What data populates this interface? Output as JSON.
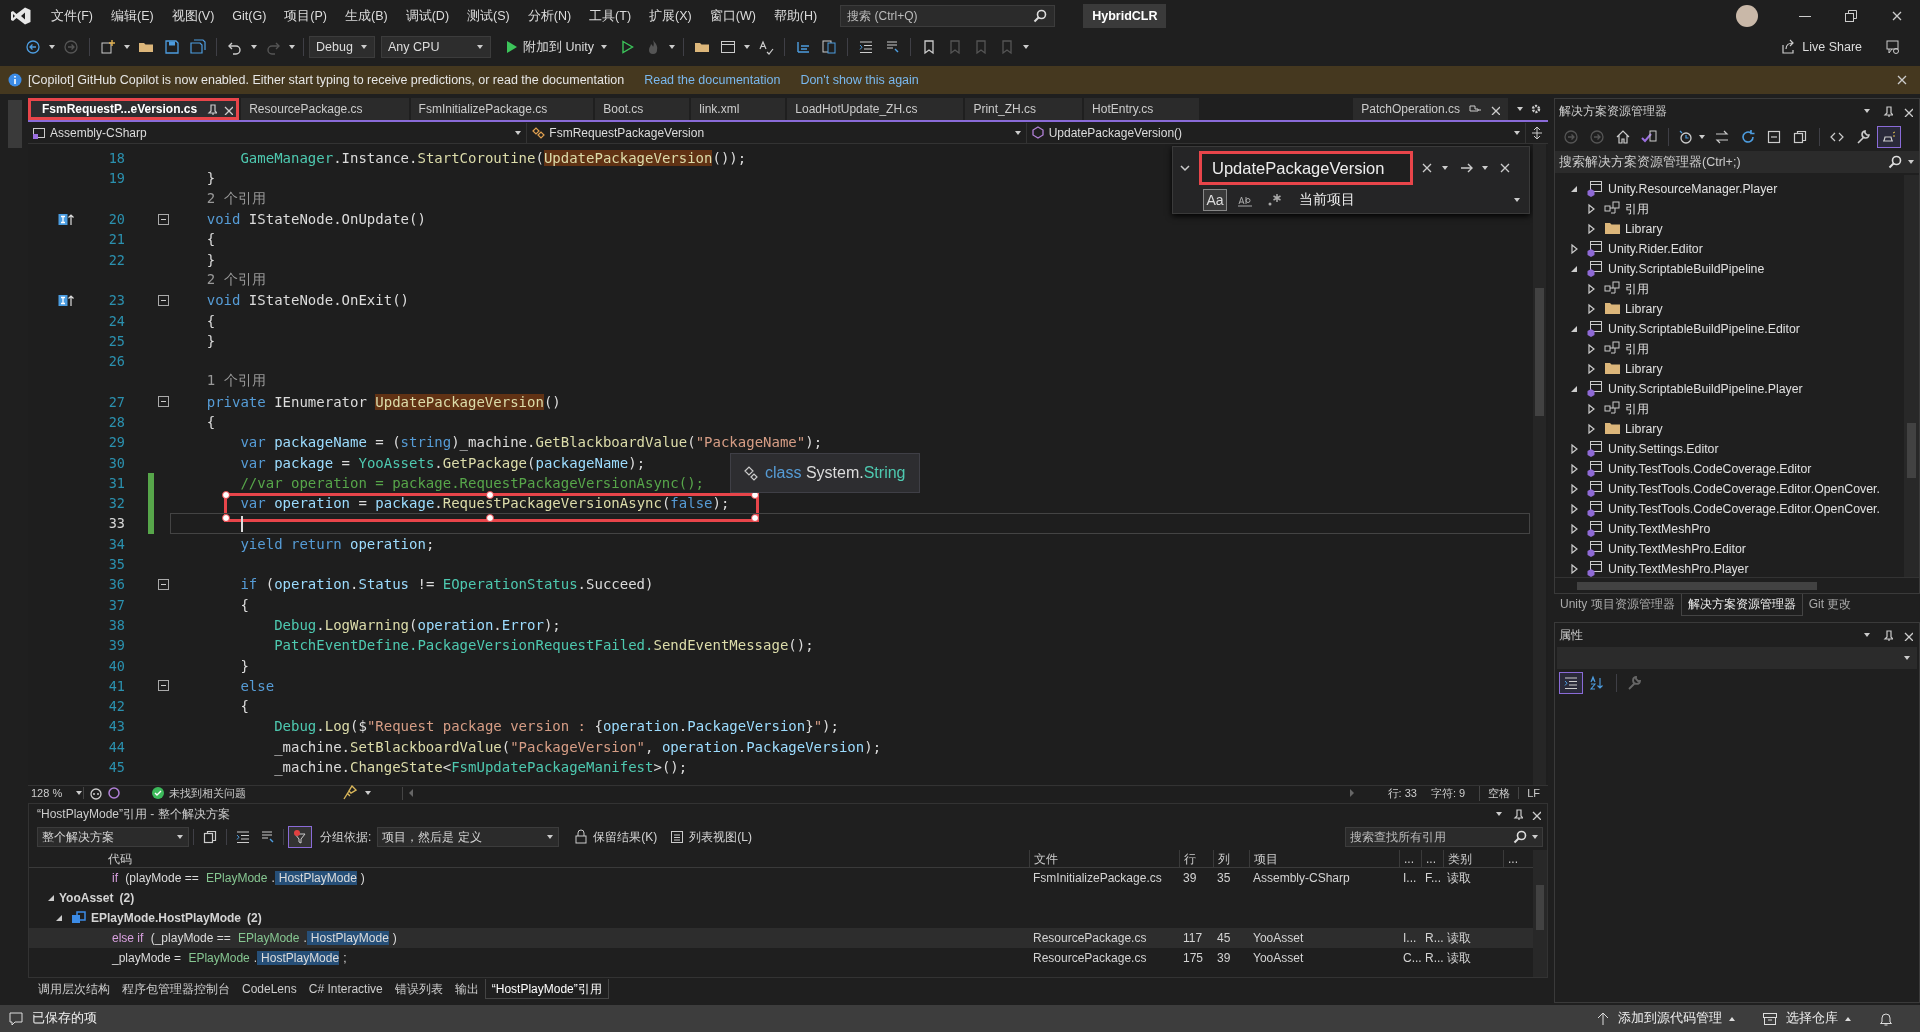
{
  "title_bar": {
    "menu": [
      "文件(F)",
      "编辑(E)",
      "视图(V)",
      "Git(G)",
      "项目(P)",
      "生成(B)",
      "调试(D)",
      "测试(S)",
      "分析(N)",
      "工具(T)",
      "扩展(X)",
      "窗口(W)",
      "帮助(H)"
    ],
    "search": {
      "placeholder": "搜索 (Ctrl+Q)"
    },
    "solution_name": "HybridCLR"
  },
  "toolbar": {
    "configuration": "Debug",
    "platform": "Any CPU",
    "attach_button": "附加到 Unity",
    "live_share": "Live Share"
  },
  "info_bar": {
    "message": "[Copilot] GitHub Copilot is now enabled. Either start typing to receive predictions, or read the documentation",
    "links": [
      "Read the documentation",
      "Don't show this again"
    ]
  },
  "editor": {
    "tabs": [
      {
        "label": "FsmRequestP...eVersion.cs",
        "selected": true,
        "annotated": true
      },
      {
        "label": "ResourcePackage.cs",
        "selected": false,
        "annotated": false
      },
      {
        "label": "FsmInitializePackage.cs",
        "selected": false,
        "annotated": false
      },
      {
        "label": "Boot.cs",
        "selected": false,
        "annotated": false
      },
      {
        "label": "link.xml",
        "selected": false,
        "annotated": false
      },
      {
        "label": "LoadHotUpdate_ZH.cs",
        "selected": false,
        "annotated": false
      },
      {
        "label": "Print_ZH.cs",
        "selected": false,
        "annotated": false
      },
      {
        "label": "HotEntry.cs",
        "selected": false,
        "annotated": false
      }
    ],
    "pinned_tabs": [
      {
        "label": "PatchOperation.cs",
        "selected": false
      }
    ],
    "nav": {
      "project": "Assembly-CSharp",
      "type": "FsmRequestPackageVersion",
      "member": "UpdatePackageVersion()"
    },
    "find": {
      "value": "UpdatePackageVersion",
      "annotated": true,
      "match_case_label": "Aa",
      "match_case": true,
      "whole_word": false,
      "regex": false,
      "scope": "当前项目"
    },
    "lines": [
      {
        "kind": "code",
        "number": "18",
        "tokens": [
          {
            "text": "        GameManager",
            "kind": "type"
          },
          {
            "text": ".Instance.",
            "kind": "plain"
          },
          {
            "text": "StartCoroutine",
            "kind": "method"
          },
          {
            "text": "(",
            "kind": "plain"
          },
          {
            "text": "UpdatePackageVersion",
            "kind": "reference"
          },
          {
            "text": "());",
            "kind": "plain"
          }
        ]
      },
      {
        "kind": "code",
        "number": "19",
        "tokens": [
          {
            "text": "    }",
            "kind": "plain"
          }
        ]
      },
      {
        "kind": "codelens",
        "text": "    2 个引用"
      },
      {
        "kind": "code",
        "number": "20",
        "implements": true,
        "fold": true,
        "tokens": [
          {
            "text": "    void",
            "kind": "keyword"
          },
          {
            "text": " IStateNode.OnUpdate()",
            "kind": "plain"
          }
        ]
      },
      {
        "kind": "code",
        "number": "21",
        "tokens": [
          {
            "text": "    {",
            "kind": "plain"
          }
        ]
      },
      {
        "kind": "code",
        "number": "22",
        "tokens": [
          {
            "text": "    }",
            "kind": "plain"
          }
        ]
      },
      {
        "kind": "codelens",
        "text": "    2 个引用"
      },
      {
        "kind": "code",
        "number": "23",
        "implements": true,
        "fold": true,
        "tokens": [
          {
            "text": "    void",
            "kind": "keyword"
          },
          {
            "text": " IStateNode.OnExit()",
            "kind": "plain"
          }
        ]
      },
      {
        "kind": "code",
        "number": "24",
        "tokens": [
          {
            "text": "    {",
            "kind": "plain"
          }
        ]
      },
      {
        "kind": "code",
        "number": "25",
        "tokens": [
          {
            "text": "    }",
            "kind": "plain"
          }
        ]
      },
      {
        "kind": "code",
        "number": "26"
      },
      {
        "kind": "codelens",
        "text": "    1 个引用"
      },
      {
        "kind": "code",
        "number": "27",
        "fold": true,
        "tokens": [
          {
            "text": "    private",
            "kind": "keyword"
          },
          {
            "text": " IEnumerator ",
            "kind": "plain"
          },
          {
            "text": "UpdatePackageVersion",
            "kind": "reference"
          },
          {
            "text": "()",
            "kind": "plain"
          }
        ]
      },
      {
        "kind": "code",
        "number": "28",
        "tokens": [
          {
            "text": "    {",
            "kind": "plain"
          }
        ]
      },
      {
        "kind": "code",
        "number": "29",
        "tokens": [
          {
            "text": "        var",
            "kind": "keyword"
          },
          {
            "text": " packageName",
            "kind": "variable"
          },
          {
            "text": " = (",
            "kind": "plain"
          },
          {
            "text": "string",
            "kind": "keyword"
          },
          {
            "text": ")_machine.",
            "kind": "plain"
          },
          {
            "text": "GetBlackboardValue",
            "kind": "method"
          },
          {
            "text": "(",
            "kind": "plain"
          },
          {
            "text": "\"PackageName\"",
            "kind": "string"
          },
          {
            "text": ");",
            "kind": "plain"
          }
        ]
      },
      {
        "kind": "code",
        "number": "30",
        "tokens": [
          {
            "text": "        var",
            "kind": "keyword"
          },
          {
            "text": " package",
            "kind": "variable"
          },
          {
            "text": " = ",
            "kind": "plain"
          },
          {
            "text": "YooAssets",
            "kind": "type"
          },
          {
            "text": ".",
            "kind": "plain"
          },
          {
            "text": "GetPackage",
            "kind": "method"
          },
          {
            "text": "(",
            "kind": "plain"
          },
          {
            "text": "packageName",
            "kind": "variable"
          },
          {
            "text": ");",
            "kind": "plain"
          }
        ]
      },
      {
        "kind": "code",
        "number": "31",
        "changed": true,
        "tokens": [
          {
            "text": "        //var operation = package.RequestPackageVersionAsync();",
            "kind": "comment"
          }
        ]
      },
      {
        "kind": "code",
        "number": "32",
        "changed": true,
        "annotated": true,
        "tokens": [
          {
            "text": "        var",
            "kind": "keyword"
          },
          {
            "text": " operation",
            "kind": "variable"
          },
          {
            "text": " = ",
            "kind": "plain"
          },
          {
            "text": "package",
            "kind": "variable"
          },
          {
            "text": ".",
            "kind": "plain"
          },
          {
            "text": "RequestPackageVersionAsync",
            "kind": "method"
          },
          {
            "text": "(",
            "kind": "plain"
          },
          {
            "text": "false",
            "kind": "keyword"
          },
          {
            "text": ");",
            "kind": "plain"
          }
        ]
      },
      {
        "kind": "code",
        "number": "33",
        "changed": true,
        "current": true
      },
      {
        "kind": "code",
        "number": "34",
        "tokens": [
          {
            "text": "        yield return",
            "kind": "keyword"
          },
          {
            "text": " operation",
            "kind": "variable"
          },
          {
            "text": ";",
            "kind": "plain"
          }
        ]
      },
      {
        "kind": "code",
        "number": "35"
      },
      {
        "kind": "code",
        "number": "36",
        "fold": true,
        "tokens": [
          {
            "text": "        if",
            "kind": "keyword"
          },
          {
            "text": " (",
            "kind": "plain"
          },
          {
            "text": "operation",
            "kind": "variable"
          },
          {
            "text": ".",
            "kind": "plain"
          },
          {
            "text": "Status",
            "kind": "variable"
          },
          {
            "text": " != ",
            "kind": "plain"
          },
          {
            "text": "EOperationStatus",
            "kind": "type"
          },
          {
            "text": ".Succeed)",
            "kind": "plain"
          }
        ]
      },
      {
        "kind": "code",
        "number": "37",
        "tokens": [
          {
            "text": "        {",
            "kind": "plain"
          }
        ]
      },
      {
        "kind": "code",
        "number": "38",
        "tokens": [
          {
            "text": "            Debug",
            "kind": "type"
          },
          {
            "text": ".",
            "kind": "plain"
          },
          {
            "text": "LogWarning",
            "kind": "method"
          },
          {
            "text": "(",
            "kind": "plain"
          },
          {
            "text": "operation",
            "kind": "variable"
          },
          {
            "text": ".",
            "kind": "plain"
          },
          {
            "text": "Error",
            "kind": "variable"
          },
          {
            "text": ");",
            "kind": "plain"
          }
        ]
      },
      {
        "kind": "code",
        "number": "39",
        "tokens": [
          {
            "text": "            PatchEventDefine",
            "kind": "type"
          },
          {
            "text": ".PackageVersionRequestFailed.",
            "kind": "type"
          },
          {
            "text": "SendEventMessage",
            "kind": "method"
          },
          {
            "text": "();",
            "kind": "plain"
          }
        ]
      },
      {
        "kind": "code",
        "number": "40",
        "tokens": [
          {
            "text": "        }",
            "kind": "plain"
          }
        ]
      },
      {
        "kind": "code",
        "number": "41",
        "fold": true,
        "tokens": [
          {
            "text": "        else",
            "kind": "keyword"
          }
        ]
      },
      {
        "kind": "code",
        "number": "42",
        "tokens": [
          {
            "text": "        {",
            "kind": "plain"
          }
        ]
      },
      {
        "kind": "code",
        "number": "43",
        "tokens": [
          {
            "text": "            Debug",
            "kind": "type"
          },
          {
            "text": ".",
            "kind": "plain"
          },
          {
            "text": "Log",
            "kind": "method"
          },
          {
            "text": "($",
            "kind": "plain"
          },
          {
            "text": "\"Request package version : ",
            "kind": "string"
          },
          {
            "text": "{",
            "kind": "plain"
          },
          {
            "text": "operation",
            "kind": "variable"
          },
          {
            "text": ".",
            "kind": "plain"
          },
          {
            "text": "PackageVersion",
            "kind": "variable"
          },
          {
            "text": "}",
            "kind": "plain"
          },
          {
            "text": "\"",
            "kind": "string"
          },
          {
            "text": ");",
            "kind": "plain"
          }
        ]
      },
      {
        "kind": "code",
        "number": "44",
        "tokens": [
          {
            "text": "            _machine.",
            "kind": "plain"
          },
          {
            "text": "SetBlackboardValue",
            "kind": "method"
          },
          {
            "text": "(",
            "kind": "plain"
          },
          {
            "text": "\"PackageVersion\"",
            "kind": "string"
          },
          {
            "text": ", ",
            "kind": "plain"
          },
          {
            "text": "operation",
            "kind": "variable"
          },
          {
            "text": ".",
            "kind": "plain"
          },
          {
            "text": "PackageVersion",
            "kind": "variable"
          },
          {
            "text": ");",
            "kind": "plain"
          }
        ]
      },
      {
        "kind": "code",
        "number": "45",
        "tokens": [
          {
            "text": "            _machine.",
            "kind": "plain"
          },
          {
            "text": "ChangeState",
            "kind": "method"
          },
          {
            "text": "<",
            "kind": "plain"
          },
          {
            "text": "FsmUpdatePackageManifest",
            "kind": "type"
          },
          {
            "text": ">();",
            "kind": "plain"
          }
        ]
      }
    ],
    "tooltip": {
      "tokens": [
        {
          "text": "class",
          "kind": "keyword"
        },
        {
          "text": " System.",
          "kind": "plain"
        },
        {
          "text": "String",
          "kind": "type"
        }
      ]
    },
    "status": {
      "zoom": "128 %",
      "issues": "未找到相关问题",
      "line": "行: 33",
      "char": "字符: 9",
      "spacing": "空格",
      "eol": "LF"
    }
  },
  "references": {
    "title": "“HostPlayMode”引用 - 整个解决方案",
    "scope": "整个解决方案",
    "group_by_label": "分组依据:",
    "group_by": "项目，然后是 定义",
    "keep_results": "保留结果(K)",
    "list_view": "列表视图(L)",
    "search": {
      "placeholder": "搜索查找所有引用"
    },
    "columns": [
      "代码",
      "文件",
      "行",
      "列",
      "项目",
      "...",
      "...",
      "类别",
      "..."
    ],
    "items": [
      {
        "kind": "result",
        "selected": false,
        "code": [
          {
            "text": "if",
            "kind": "keyword"
          },
          {
            "text": " (playMode == ",
            "kind": "plain"
          },
          {
            "text": "EPlayMode",
            "kind": "type"
          },
          {
            "text": ".",
            "kind": "plain"
          },
          {
            "text": "HostPlayMode",
            "kind": "match"
          },
          {
            "text": ")",
            "kind": "plain"
          }
        ],
        "cells": [
          "FsmInitializePackage.cs",
          "39",
          "35",
          "Assembly-CSharp",
          "I...",
          "F...",
          "读取"
        ]
      },
      {
        "kind": "group",
        "label": "YooAsset",
        "count": "(2)",
        "expanded": true,
        "children": [
          {
            "kind": "group",
            "label": "EPlayMode.HostPlayMode",
            "count": "(2)",
            "expanded": true,
            "children": [
              {
                "kind": "result",
                "selected": true,
                "code": [
                  {
                    "text": "else if",
                    "kind": "keyword"
                  },
                  {
                    "text": " (_playMode == ",
                    "kind": "plain"
                  },
                  {
                    "text": "EPlayMode",
                    "kind": "type"
                  },
                  {
                    "text": ".",
                    "kind": "plain"
                  },
                  {
                    "text": "HostPlayMode",
                    "kind": "match"
                  },
                  {
                    "text": ")",
                    "kind": "plain"
                  }
                ],
                "cells": [
                  "ResourcePackage.cs",
                  "117",
                  "45",
                  "YooAsset",
                  "I...",
                  "R...",
                  "读取"
                ]
              },
              {
                "kind": "result",
                "selected": false,
                "code": [
                  {
                    "text": "_playMode = ",
                    "kind": "plain"
                  },
                  {
                    "text": "EPlayMode",
                    "kind": "type"
                  },
                  {
                    "text": ".",
                    "kind": "plain"
                  },
                  {
                    "text": "HostPlayMode",
                    "kind": "match"
                  },
                  {
                    "text": ";",
                    "kind": "plain"
                  }
                ],
                "cells": [
                  "ResourcePackage.cs",
                  "175",
                  "39",
                  "YooAsset",
                  "C...",
                  "R...",
                  "读取"
                ]
              }
            ]
          }
        ]
      }
    ]
  },
  "tool_tabs": [
    {
      "label": "调用层次结构",
      "selected": false
    },
    {
      "label": "程序包管理器控制台",
      "selected": false
    },
    {
      "label": "CodeLens",
      "selected": false
    },
    {
      "label": "C# Interactive",
      "selected": false
    },
    {
      "label": "错误列表",
      "selected": false
    },
    {
      "label": "输出",
      "selected": false
    },
    {
      "label": "“HostPlayMode”引用",
      "selected": true
    }
  ],
  "solution_explorer": {
    "title": "解决方案资源管理器",
    "search": {
      "placeholder": "搜索解决方案资源管理器(Ctrl+;)"
    },
    "tree": [
      {
        "label": "Unity.ResourceManager.Player",
        "kind": "project",
        "expanded": true,
        "children": [
          {
            "label": "引用",
            "kind": "references",
            "expanded": false
          },
          {
            "label": "Library",
            "kind": "folder",
            "expanded": false
          }
        ]
      },
      {
        "label": "Unity.Rider.Editor",
        "kind": "project",
        "expanded": false
      },
      {
        "label": "Unity.ScriptableBuildPipeline",
        "kind": "project",
        "expanded": true,
        "children": [
          {
            "label": "引用",
            "kind": "references",
            "expanded": false
          },
          {
            "label": "Library",
            "kind": "folder",
            "expanded": false
          }
        ]
      },
      {
        "label": "Unity.ScriptableBuildPipeline.Editor",
        "kind": "project",
        "expanded": true,
        "children": [
          {
            "label": "引用",
            "kind": "references",
            "expanded": false
          },
          {
            "label": "Library",
            "kind": "folder",
            "expanded": false
          }
        ]
      },
      {
        "label": "Unity.ScriptableBuildPipeline.Player",
        "kind": "project",
        "expanded": true,
        "children": [
          {
            "label": "引用",
            "kind": "references",
            "expanded": false
          },
          {
            "label": "Library",
            "kind": "folder",
            "expanded": false
          }
        ]
      },
      {
        "label": "Unity.Settings.Editor",
        "kind": "project",
        "expanded": false
      },
      {
        "label": "Unity.TestTools.CodeCoverage.Editor",
        "kind": "project",
        "expanded": false
      },
      {
        "label": "Unity.TestTools.CodeCoverage.Editor.OpenCover.",
        "kind": "project",
        "expanded": false
      },
      {
        "label": "Unity.TestTools.CodeCoverage.Editor.OpenCover.",
        "kind": "project",
        "expanded": false
      },
      {
        "label": "Unity.TextMeshPro",
        "kind": "project",
        "expanded": false
      },
      {
        "label": "Unity.TextMeshPro.Editor",
        "kind": "project",
        "expanded": false
      },
      {
        "label": "Unity.TextMeshPro.Player",
        "kind": "project",
        "expanded": false
      }
    ],
    "tabs": [
      {
        "label": "Unity 项目资源管理器",
        "selected": false
      },
      {
        "label": "解决方案资源管理器",
        "selected": true
      },
      {
        "label": "Git 更改",
        "selected": false
      }
    ]
  },
  "properties": {
    "title": "属性"
  },
  "status_bar": {
    "message": "已保存的项",
    "source_control": "添加到源代码管理",
    "repository": "选择仓库"
  }
}
